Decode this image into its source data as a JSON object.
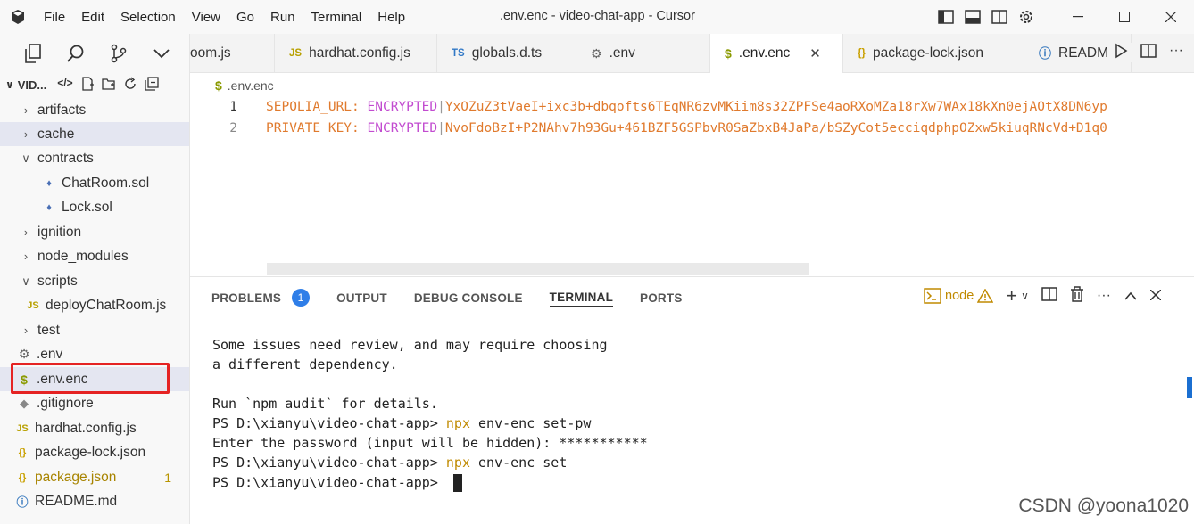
{
  "titlebar": {
    "menu": [
      "File",
      "Edit",
      "Selection",
      "View",
      "Go",
      "Run",
      "Terminal",
      "Help"
    ],
    "title": ".env.enc - video-chat-app - Cursor"
  },
  "sidebar": {
    "project": "VID...",
    "items": [
      {
        "label": "artifacts",
        "type": "folder",
        "expanded": false
      },
      {
        "label": "cache",
        "type": "folder",
        "expanded": false
      },
      {
        "label": "contracts",
        "type": "folder",
        "expanded": true
      },
      {
        "label": "ChatRoom.sol",
        "type": "sol"
      },
      {
        "label": "Lock.sol",
        "type": "sol"
      },
      {
        "label": "ignition",
        "type": "folder",
        "expanded": false
      },
      {
        "label": "node_modules",
        "type": "folder",
        "expanded": false
      },
      {
        "label": "scripts",
        "type": "folder",
        "expanded": true
      },
      {
        "label": "deployChatRoom.js",
        "type": "js"
      },
      {
        "label": "test",
        "type": "folder",
        "expanded": false
      },
      {
        "label": ".env",
        "type": "env-gear"
      },
      {
        "label": ".env.enc",
        "type": "env-dollar"
      },
      {
        "label": ".gitignore",
        "type": "git"
      },
      {
        "label": "hardhat.config.js",
        "type": "js"
      },
      {
        "label": "package-lock.json",
        "type": "json"
      },
      {
        "label": "package.json",
        "type": "json",
        "badge": "1"
      },
      {
        "label": "README.md",
        "type": "info"
      }
    ]
  },
  "tabs": [
    {
      "label": "oom.js",
      "icon": ""
    },
    {
      "label": "hardhat.config.js",
      "icon": "JS"
    },
    {
      "label": "globals.d.ts",
      "icon": "TS"
    },
    {
      "label": ".env",
      "icon": "gear"
    },
    {
      "label": ".env.enc",
      "icon": "$",
      "active": true
    },
    {
      "label": "package-lock.json",
      "icon": "{}"
    },
    {
      "label": "READM",
      "icon": "info"
    }
  ],
  "editor": {
    "breadcrumb": ".env.enc",
    "lines": [
      {
        "num": "1",
        "key": "SEPOLIA_URL:",
        "enc": "ENCRYPTED",
        "value": "YxOZuZ3tVaeI+ixc3b+dbqofts6TEqNR6zvMKiim8s32ZPFSe4aoRXoMZa18rXw7WAx18kXn0ejAOtX8DN6yp"
      },
      {
        "num": "2",
        "key": "PRIVATE_KEY:",
        "enc": "ENCRYPTED",
        "value": "NvoFdoBzI+P2NAhv7h93Gu+461BZF5GSPbvR0SaZbxB4JaPa/bSZyCot5ecciqdphpOZxw5kiuqRNcVd+D1q0"
      }
    ]
  },
  "panel": {
    "tabs": [
      "PROBLEMS",
      "OUTPUT",
      "DEBUG CONSOLE",
      "TERMINAL",
      "PORTS"
    ],
    "problems_count": "1",
    "shell": "node",
    "terminal": [
      {
        "text": "Some issues need review, and may require choosing"
      },
      {
        "text": "a different dependency."
      },
      {
        "text": ""
      },
      {
        "text": "Run `npm audit` for details."
      },
      {
        "prompt": "PS D:\\xianyu\\video-chat-app> ",
        "cmd": "npx",
        "rest": " env-enc set-pw"
      },
      {
        "text": "Enter the password (input will be hidden): ***********"
      },
      {
        "prompt": "PS D:\\xianyu\\video-chat-app> ",
        "cmd": "npx",
        "rest": " env-enc set"
      },
      {
        "prompt": "PS D:\\xianyu\\video-chat-app> "
      }
    ]
  },
  "watermark": "CSDN @yoona1020"
}
